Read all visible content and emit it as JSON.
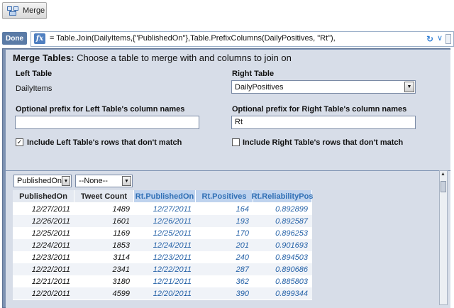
{
  "toolbar": {
    "merge_label": "Merge"
  },
  "formula": {
    "done_label": "Done",
    "fx_label": "fx",
    "text": "= Table.Join(DailyItems,{\"PublishedOn\"},Table.PrefixColumns(DailyPositives, \"Rt\"),"
  },
  "merge": {
    "title_bold": "Merge Tables:",
    "title_rest": "Choose a table to merge with and columns to join on",
    "left_table_label": "Left Table",
    "left_table_value": "DailyItems",
    "right_table_label": "Right Table",
    "right_table_value": "DailyPositives",
    "left_prefix_label": "Optional prefix for Left Table's column names",
    "left_prefix_value": "",
    "right_prefix_label": "Optional prefix for Right Table's column names",
    "right_prefix_value": "Rt",
    "left_include_label": "Include Left Table's rows that don't match",
    "left_include_checked": true,
    "right_include_label": "Include Right Table's rows that don't match",
    "right_include_checked": false,
    "join_column_1": "PublishedOn",
    "join_column_2": "--None--"
  },
  "grid": {
    "columns": [
      "PublishedOn",
      "Tweet Count",
      "Rt.PublishedOn",
      "Rt.Positives",
      "Rt.ReliabilityPos"
    ],
    "rows": [
      [
        "12/27/2011",
        "1489",
        "12/27/2011",
        "164",
        "0.892899"
      ],
      [
        "12/26/2011",
        "1601",
        "12/26/2011",
        "193",
        "0.892587"
      ],
      [
        "12/25/2011",
        "1169",
        "12/25/2011",
        "170",
        "0.896253"
      ],
      [
        "12/24/2011",
        "1853",
        "12/24/2011",
        "201",
        "0.901693"
      ],
      [
        "12/23/2011",
        "3114",
        "12/23/2011",
        "240",
        "0.894503"
      ],
      [
        "12/22/2011",
        "2341",
        "12/22/2011",
        "287",
        "0.890686"
      ],
      [
        "12/21/2011",
        "3180",
        "12/21/2011",
        "362",
        "0.885803"
      ],
      [
        "12/20/2011",
        "4599",
        "12/20/2011",
        "390",
        "0.899344"
      ]
    ]
  },
  "icons": {
    "merge": "merge-table-icon",
    "fx": "fx-icon",
    "refresh": "refresh-icon",
    "chevron": "chevron-down-icon",
    "checkmark": "✓",
    "dropdown_arrow": "▼",
    "scroll_up": "▲"
  },
  "colors": {
    "panel": "#7d92b2",
    "panel_inner": "#d7dde8",
    "done_button": "#5b7ba6",
    "right_header_bg": "#bfd3ee",
    "right_text": "#2763a8"
  }
}
